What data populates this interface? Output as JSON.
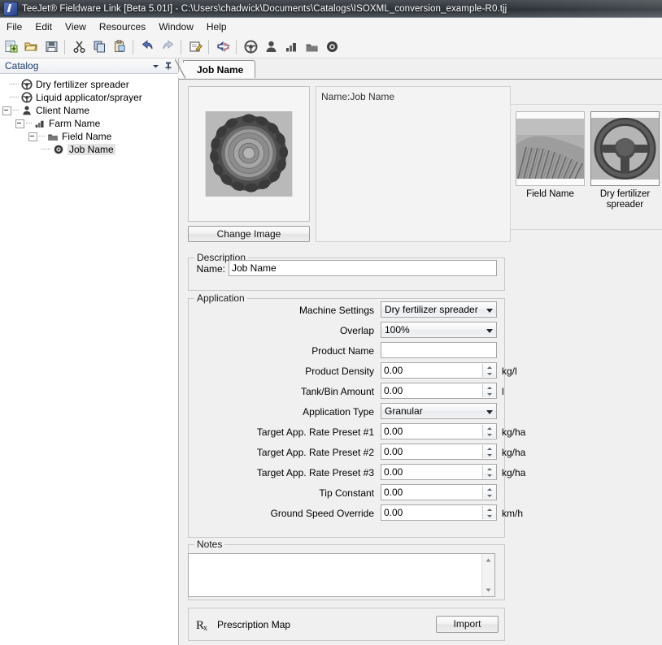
{
  "window": {
    "title": "TeeJet® Fieldware Link [Beta 5.01I] - C:\\Users\\chadwick\\Documents\\Catalogs\\ISOXML_conversion_example-R0.tjj",
    "app_icon": "application-icon"
  },
  "menubar": {
    "items": [
      {
        "label": "File"
      },
      {
        "label": "Edit"
      },
      {
        "label": "View"
      },
      {
        "label": "Resources"
      },
      {
        "label": "Window"
      },
      {
        "label": "Help"
      }
    ]
  },
  "toolbar": {
    "buttons": [
      {
        "name": "new-icon",
        "title": "New"
      },
      {
        "name": "open-icon",
        "title": "Open"
      },
      {
        "name": "save-icon",
        "title": "Save"
      },
      {
        "name": "cut-icon",
        "title": "Cut"
      },
      {
        "name": "copy-icon",
        "title": "Copy"
      },
      {
        "name": "paste-icon",
        "title": "Paste"
      },
      {
        "name": "undo-icon",
        "title": "Undo"
      },
      {
        "name": "redo-icon",
        "title": "Redo"
      },
      {
        "name": "rename-icon",
        "title": "Rename"
      },
      {
        "name": "transfer-icon",
        "title": "Transfer"
      },
      {
        "name": "machine-icon",
        "title": "Machine"
      },
      {
        "name": "client-icon",
        "title": "Client"
      },
      {
        "name": "farm-icon",
        "title": "Farm"
      },
      {
        "name": "field-icon",
        "title": "Field"
      },
      {
        "name": "job-icon",
        "title": "Job"
      }
    ]
  },
  "catalog": {
    "title": "Catalog",
    "header_icons": [
      {
        "name": "chevron-down-icon"
      },
      {
        "name": "pin-icon"
      }
    ],
    "tree": [
      {
        "label": "Dry fertilizer spreader",
        "icon": "steering-wheel-icon",
        "depth": 1,
        "expander": "none",
        "selected": false
      },
      {
        "label": "Liquid applicator/sprayer",
        "icon": "steering-wheel-icon",
        "depth": 1,
        "expander": "none",
        "selected": false
      },
      {
        "label": "Client Name",
        "icon": "client-icon",
        "depth": 0,
        "expander": "minus",
        "selected": false
      },
      {
        "label": "Farm Name",
        "icon": "farm-icon",
        "depth": 1,
        "expander": "minus",
        "selected": false
      },
      {
        "label": "Field Name",
        "icon": "field-icon",
        "depth": 2,
        "expander": "minus",
        "selected": false
      },
      {
        "label": "Job Name",
        "icon": "job-icon",
        "depth": 3,
        "expander": "none",
        "selected": true
      }
    ]
  },
  "main": {
    "tab": {
      "label": "Job Name"
    },
    "image_box": {
      "alt": "tractor-tire-image"
    },
    "change_image_label": "Change Image",
    "name_summary": "Name:Job Name",
    "thumbnails": [
      {
        "caption": "Field Name",
        "icon": "field-image"
      },
      {
        "caption": "Dry fertilizer spreader",
        "icon": "steering-wheel-image"
      }
    ],
    "description": {
      "group_title": "Description",
      "name_label": "Name:",
      "name_value": "Job Name"
    },
    "application": {
      "group_title": "Application",
      "fields": [
        {
          "label": "Machine Settings",
          "type": "combo",
          "value": "Dry fertilizer spreader",
          "unit": ""
        },
        {
          "label": "Overlap",
          "type": "combo",
          "value": "100%",
          "unit": ""
        },
        {
          "label": "Product Name",
          "type": "text",
          "value": "",
          "unit": ""
        },
        {
          "label": "Product Density",
          "type": "spinner",
          "value": "0.00",
          "unit": "kg/l"
        },
        {
          "label": "Tank/Bin Amount",
          "type": "spinner",
          "value": "0.00",
          "unit": "l"
        },
        {
          "label": "Application Type",
          "type": "combo",
          "value": "Granular",
          "unit": ""
        },
        {
          "label": "Target App. Rate Preset #1",
          "type": "spinner",
          "value": "0.00",
          "unit": "kg/ha"
        },
        {
          "label": "Target App. Rate Preset #2",
          "type": "spinner",
          "value": "0.00",
          "unit": "kg/ha"
        },
        {
          "label": "Target App. Rate Preset #3",
          "type": "spinner",
          "value": "0.00",
          "unit": "kg/ha"
        },
        {
          "label": "Tip Constant",
          "type": "spinner",
          "value": "0.00",
          "unit": ""
        },
        {
          "label": "Ground Speed Override",
          "type": "spinner",
          "value": "0.00",
          "unit": "km/h"
        }
      ]
    },
    "notes": {
      "group_title": "Notes",
      "value": ""
    },
    "prescription": {
      "label": "Prescription Map",
      "icon": "rx-icon",
      "import_label": "Import"
    }
  },
  "colors": {
    "window_bg": "#f0f0f0",
    "panel_bg": "#ffffff",
    "titlebar": "#33383e",
    "catalog_title": "#1a3c6e",
    "field_border": "#a6a6a6"
  }
}
